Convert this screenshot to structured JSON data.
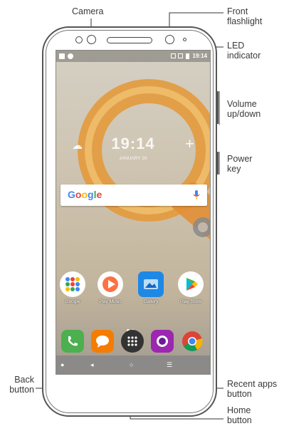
{
  "callouts": {
    "camera": "Camera",
    "front_flashlight_1": "Front",
    "front_flashlight_2": "flashlight",
    "led_1": "LED",
    "led_2": "indicator",
    "volume_1": "Volume",
    "volume_2": "up/down",
    "power_1": "Power",
    "power_2": "key",
    "back_1": "Back",
    "back_2": "button",
    "recent_1": "Recent apps",
    "recent_2": "button",
    "home_1": "Home",
    "home_2": "button"
  },
  "screen": {
    "status_time": "19:14",
    "clock_time": "19:14",
    "clock_date": "JANUARY 20",
    "search_brand": "Google",
    "apps": [
      {
        "label": "Google",
        "icon": "google-folder-icon"
      },
      {
        "label": "Play Music",
        "icon": "play-music-icon"
      },
      {
        "label": "Gallery",
        "icon": "gallery-icon"
      },
      {
        "label": "Play Store",
        "icon": "play-store-icon"
      }
    ],
    "dock": [
      "phone-icon",
      "messages-icon",
      "app-drawer-icon",
      "camera-app-icon",
      "chrome-icon"
    ]
  },
  "colors": {
    "phone_green": "#4caf50",
    "messages_orange": "#f57c00",
    "camera_purple": "#9c27b0",
    "gallery_blue": "#1e88e5",
    "q_orange": "#e39a3c"
  }
}
